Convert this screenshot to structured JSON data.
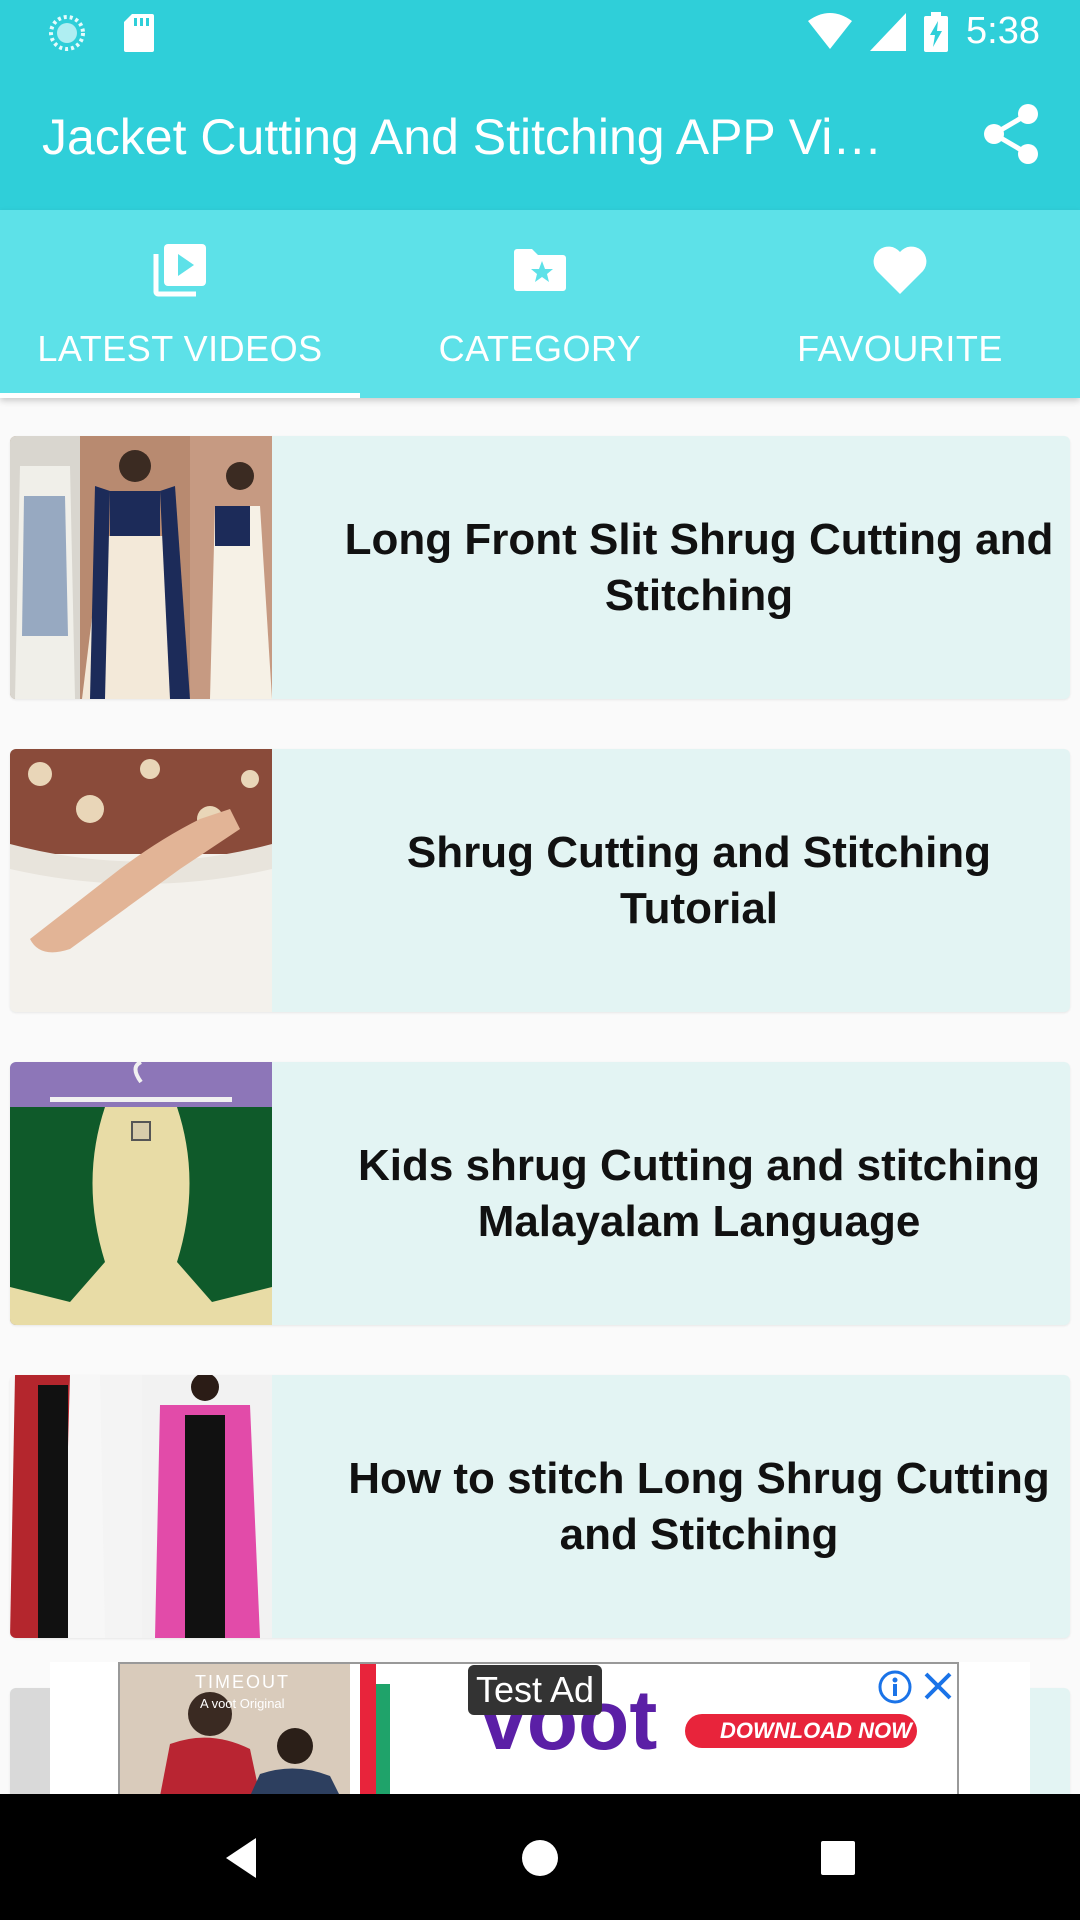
{
  "status_bar": {
    "time": "5:38",
    "icons": [
      "sync-icon",
      "sdcard-icon",
      "wifi-icon",
      "signal-icon",
      "battery-charging-icon"
    ]
  },
  "app_bar": {
    "title": "Jacket Cutting And Stitching APP Vi…",
    "share_icon": "share-icon"
  },
  "tabs": [
    {
      "label": "LATEST VIDEOS",
      "icon": "video-library-icon",
      "selected": true
    },
    {
      "label": "CATEGORY",
      "icon": "folder-star-icon",
      "selected": false
    },
    {
      "label": "FAVOURITE",
      "icon": "heart-icon",
      "selected": false
    }
  ],
  "videos": [
    {
      "title": "Long Front Slit Shrug Cutting and Stitching"
    },
    {
      "title": "Shrug Cutting and Stitching Tutorial"
    },
    {
      "title": "Kids shrug Cutting and stitching Malayalam Language"
    },
    {
      "title": "How to stitch Long Shrug Cutting and Stitching"
    }
  ],
  "ad": {
    "label": "Test Ad",
    "brand_tag": "TIMEOUT",
    "brand_sub": "A voot Original",
    "brand": "voot",
    "cta": "DOWNLOAD NOW"
  },
  "colors": {
    "primary": "#2fcfd9",
    "tab_bar": "#5de1e8",
    "card_bg": "#e3f4f3",
    "ad_purple": "#5b1fa6",
    "ad_red": "#e8243b"
  }
}
